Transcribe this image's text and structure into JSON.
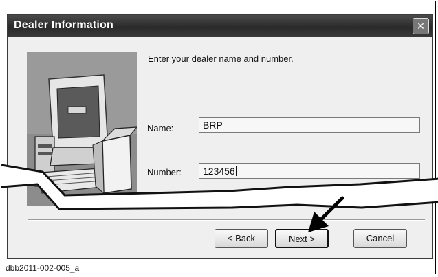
{
  "dialog": {
    "title": "Dealer Information",
    "close_label": "×",
    "prompt": "Enter your dealer name and number.",
    "name_label": "Name:",
    "name_value": "BRP",
    "number_label": "Number:",
    "number_value": "123456",
    "back_label": "< Back",
    "next_label": "Next >",
    "cancel_label": "Cancel"
  },
  "icons": {
    "close": "close-icon",
    "computer": "computer-setup-icon",
    "arrow": "pointer-arrow"
  },
  "caption": "dbb2011-002-005_a"
}
